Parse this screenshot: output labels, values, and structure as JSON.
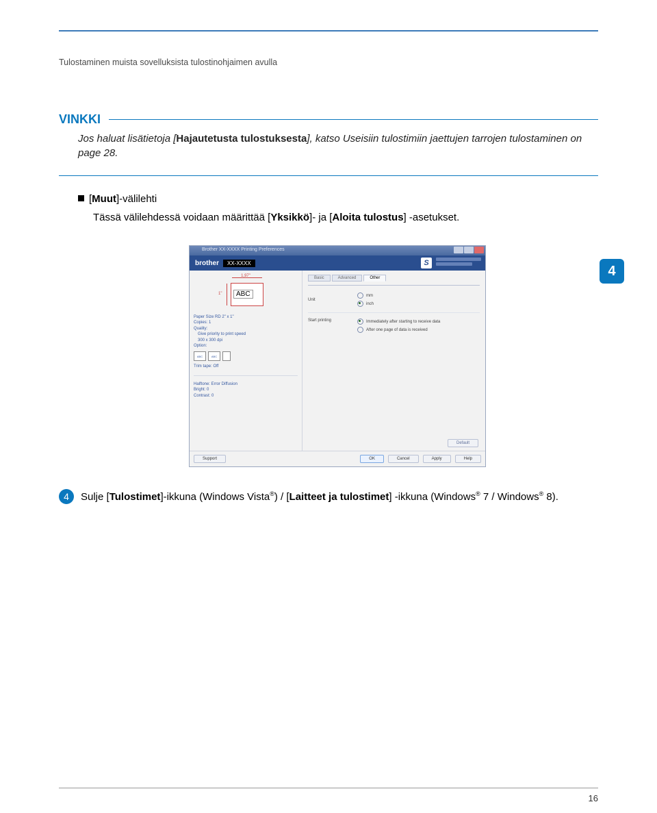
{
  "header_breadcrumb": "Tulostaminen muista sovelluksista tulostinohjaimen avulla",
  "vinkki": {
    "label": "VINKKI",
    "body_prefix": "Jos haluat lisätietoja [",
    "body_bold1": "Hajautetusta tulostuksesta",
    "body_mid": "], katso ",
    "body_link": "Useisiin tulostimiin jaettujen tarrojen tulostaminen",
    "body_suffix": " on page 28."
  },
  "bullet": {
    "title_prefix": "[",
    "title_bold": "Muut",
    "title_suffix": "]-välilehti",
    "sub_prefix": "Tässä välilehdessä voidaan määrittää [",
    "sub_bold1": "Yksikkö",
    "sub_mid": "]- ja [",
    "sub_bold2": "Aloita tulostus",
    "sub_suffix": "] -asetukset."
  },
  "chapter_tab": "4",
  "screenshot": {
    "window_title": "Brother XX-XXXX Printing Preferences",
    "brand_logo": "brother",
    "model": "XX-XXXX",
    "s_logo": "S",
    "preview": {
      "dim_top": "1,97\"",
      "dim_left": "1\"",
      "sample": "ABC"
    },
    "info": {
      "paper_size": "Paper Size RD 2\" x 1\"",
      "copies": "Copies: 1",
      "quality_label": "Quality:",
      "quality_value": "Give priority to print speed",
      "dpi": "300 x 300 dpi",
      "option_label": "Option:",
      "opt1": "ABC",
      "opt2": "ABC",
      "trim": "Trim tape: Off",
      "halftone": "Halftone: Error Diffusion",
      "bright": "Bright: 0",
      "contrast": "Contrast: 0"
    },
    "tabs": {
      "basic": "Basic",
      "advanced": "Advanced",
      "other": "Other"
    },
    "settings": {
      "unit_label": "Unit",
      "unit_mm": "mm",
      "unit_inch": "inch",
      "start_label": "Start printing",
      "start_immediate": "Immediately after starting to receive data",
      "start_after": "After one page of data is received"
    },
    "default_btn": "Default",
    "footer": {
      "support": "Support",
      "ok": "OK",
      "cancel": "Cancel",
      "apply": "Apply",
      "help": "Help"
    }
  },
  "step": {
    "num": "4",
    "text_prefix": "Sulje [",
    "bold1": "Tulostimet",
    "mid1": "]-ikkuna (Windows Vista",
    "mid2": ") / [",
    "bold2": "Laitteet ja tulostimet",
    "mid3": "] -ikkuna (Windows",
    "mid4": " 7 / Windows",
    "suffix": " 8)."
  },
  "page_number": "16"
}
